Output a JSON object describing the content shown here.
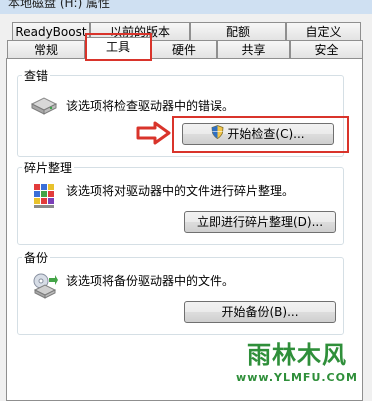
{
  "window": {
    "title": "本地磁盘 (H:) 属性"
  },
  "tabs_row1": [
    {
      "label": "ReadyBoost"
    },
    {
      "label": "以前的版本"
    },
    {
      "label": "配额"
    },
    {
      "label": "自定义"
    }
  ],
  "tabs_row2": [
    {
      "label": "常规"
    },
    {
      "label": "工具"
    },
    {
      "label": "硬件"
    },
    {
      "label": "共享"
    },
    {
      "label": "安全"
    }
  ],
  "error_check": {
    "title": "查错",
    "description": "该选项将检查驱动器中的错误。",
    "button": "开始检查(C)...",
    "icon": "hard-drive-icon"
  },
  "defrag": {
    "title": "碎片整理",
    "description": "该选项将对驱动器中的文件进行碎片整理。",
    "button": "立即进行碎片整理(D)...",
    "icon": "defrag-icon"
  },
  "backup": {
    "title": "备份",
    "description": "该选项将备份驱动器中的文件。",
    "button": "开始备份(B)...",
    "icon": "backup-icon"
  },
  "watermark": {
    "main": "雨林木风",
    "url": "www.YLMFU.COM"
  },
  "colors": {
    "highlight": "#d9342b",
    "page_bg": "#ffffff",
    "frame_bg": "#f0f0f0"
  }
}
